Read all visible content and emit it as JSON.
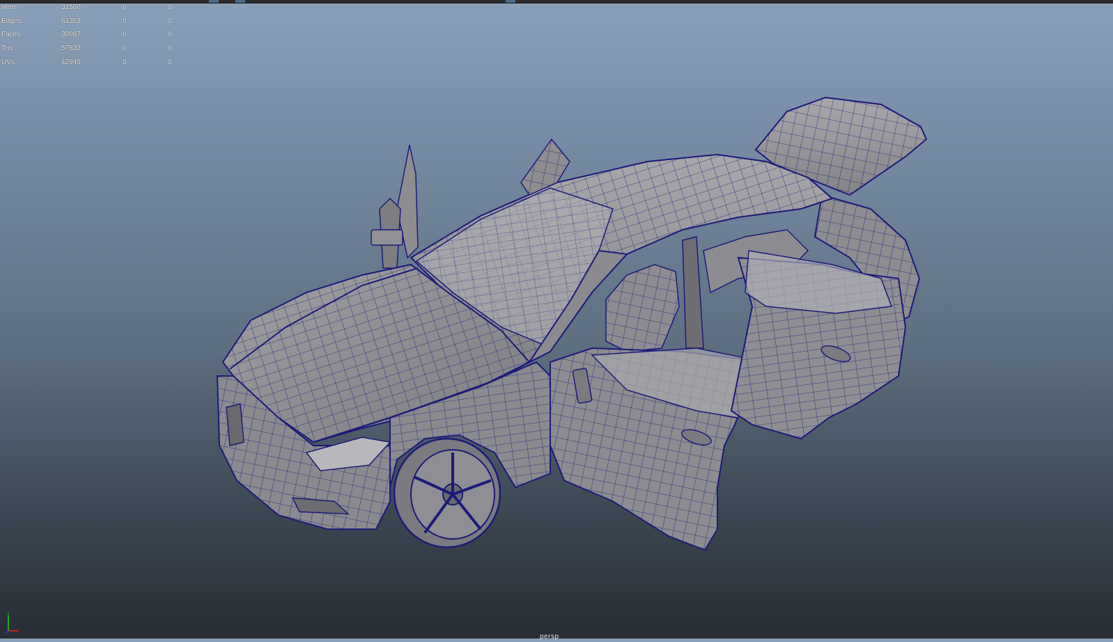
{
  "hud": {
    "rows": [
      {
        "label": "Verts:",
        "total": "31560",
        "selected": "0",
        "components": "0"
      },
      {
        "label": "Edges:",
        "total": "61353",
        "selected": "0",
        "components": "0"
      },
      {
        "label": "Faces:",
        "total": "30087",
        "selected": "0",
        "components": "0"
      },
      {
        "label": "Tris:",
        "total": "57832",
        "selected": "0",
        "components": "0"
      },
      {
        "label": "UVs:",
        "total": "42949",
        "selected": "0",
        "components": "0"
      }
    ]
  },
  "viewport": {
    "camera_label": "persp",
    "axis_labels": {
      "y": "Y",
      "x": "X"
    }
  },
  "colors": {
    "wire": "#1c1a78",
    "surface": "#8c8c90",
    "surface_light": "#a4a4a8",
    "surface_dark": "#5e5e64",
    "axis_x": "#d22",
    "axis_y": "#2c2",
    "axis_z": "#33f"
  }
}
